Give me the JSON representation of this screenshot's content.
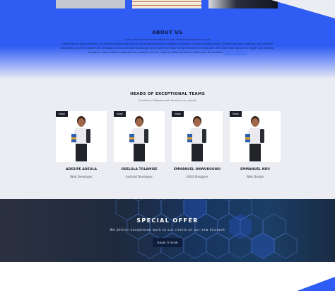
{
  "about": {
    "title": "ABOUT US",
    "lead": "If you want to know more about us, just click below to send us mail",
    "body": "Lorem ipsum dolor sit amet, consectetur adipisicing elit, sed do eiusmod tempor incididunt ut labore et dolore magna aliqua. Ut enim ad minim veniam, quis nostrud exercitation ullamco laboris nisi ut aliquip ex ea commodo consequat. Duis aute irure dolor in reprehenderit in voluptate velit esse cillum dolore eu fugiat nulla pariatur. Excepteur sint occaecat cupidatat non proident, sunt in culpa qui officia deserunt mollit anim id cupidatat.",
    "link": "I have a question."
  },
  "team": {
    "title": "HEADS OF EXCEPTIONAL TEAMS",
    "subtitle": "Excellence, Diligence and Honesty is our priority",
    "badge": "Head",
    "members": [
      {
        "name": "ADESIPE ADEOLA",
        "role": "Web Developer"
      },
      {
        "name": "ODELOLA TOLAMISE",
        "role": "Android Developer"
      },
      {
        "name": "EMMANUEL ONWUKOGWU",
        "role": "UI/UX Designer"
      },
      {
        "name": "EMMANUEL NDU",
        "role": "Web Design"
      }
    ]
  },
  "offer": {
    "title": "SPECIAL OFFER",
    "text": "We deliver exceptional work to our clients on our new discount",
    "button": "GRAB IT NOW"
  },
  "colors": {
    "accent": "#2f5cf2",
    "dark": "#0f1d3d"
  }
}
